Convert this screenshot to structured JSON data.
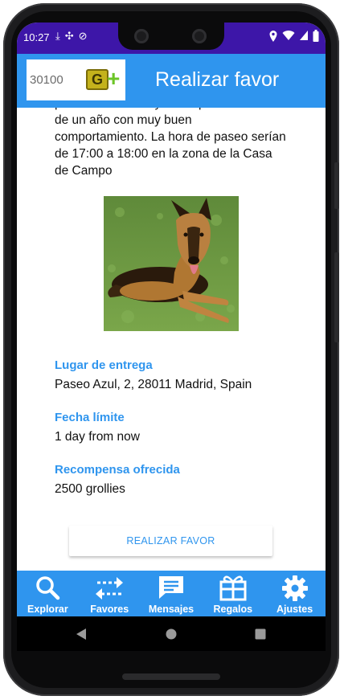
{
  "status_bar": {
    "time": "10:27",
    "left_icons": [
      "download-icon",
      "fan-icon",
      "do-not-disturb-icon"
    ],
    "right_icons": [
      "location-icon",
      "wifi-icon",
      "signal-icon",
      "battery-icon"
    ]
  },
  "app_bar": {
    "balance": "30100",
    "logo_letter": "G",
    "plus_label": "+",
    "title": "Realizar favor"
  },
  "description": "para mañana. Toby es un pastor alemán de un año con muy buen comportamiento. La hora de paseo serían de 17:00 a 18:00 en la zona de la Casa de Campo",
  "image": {
    "subject": "german-shepherd-dog"
  },
  "details": [
    {
      "label": "Lugar de entrega",
      "value": "Paseo Azul, 2, 28011 Madrid, Spain"
    },
    {
      "label": "Fecha límite",
      "value": "1 day from now"
    },
    {
      "label": "Recompensa ofrecida",
      "value": "2500 grollies"
    }
  ],
  "action_button": "REALIZAR FAVOR",
  "bottom_nav": [
    {
      "label": "Explorar",
      "icon": "search-icon"
    },
    {
      "label": "Favores",
      "icon": "swap-arrows-icon"
    },
    {
      "label": "Mensajes",
      "icon": "message-icon"
    },
    {
      "label": "Regalos",
      "icon": "gift-icon"
    },
    {
      "label": "Ajustes",
      "icon": "gear-icon"
    }
  ],
  "colors": {
    "status_bar": "#3d16a8",
    "primary": "#2f95ee",
    "accent_green": "#6cc527"
  }
}
